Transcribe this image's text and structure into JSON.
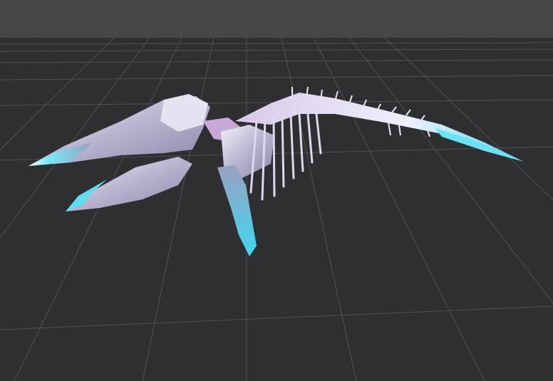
{
  "viewport": {
    "sky_color": "#474747",
    "ground_color": "#2f2f31",
    "grid_color": "#5a5a5e",
    "model": {
      "bone_color": "#e8e4f4",
      "tint_color": "#c8a8d8",
      "glow_color": "#58e0f0"
    }
  }
}
